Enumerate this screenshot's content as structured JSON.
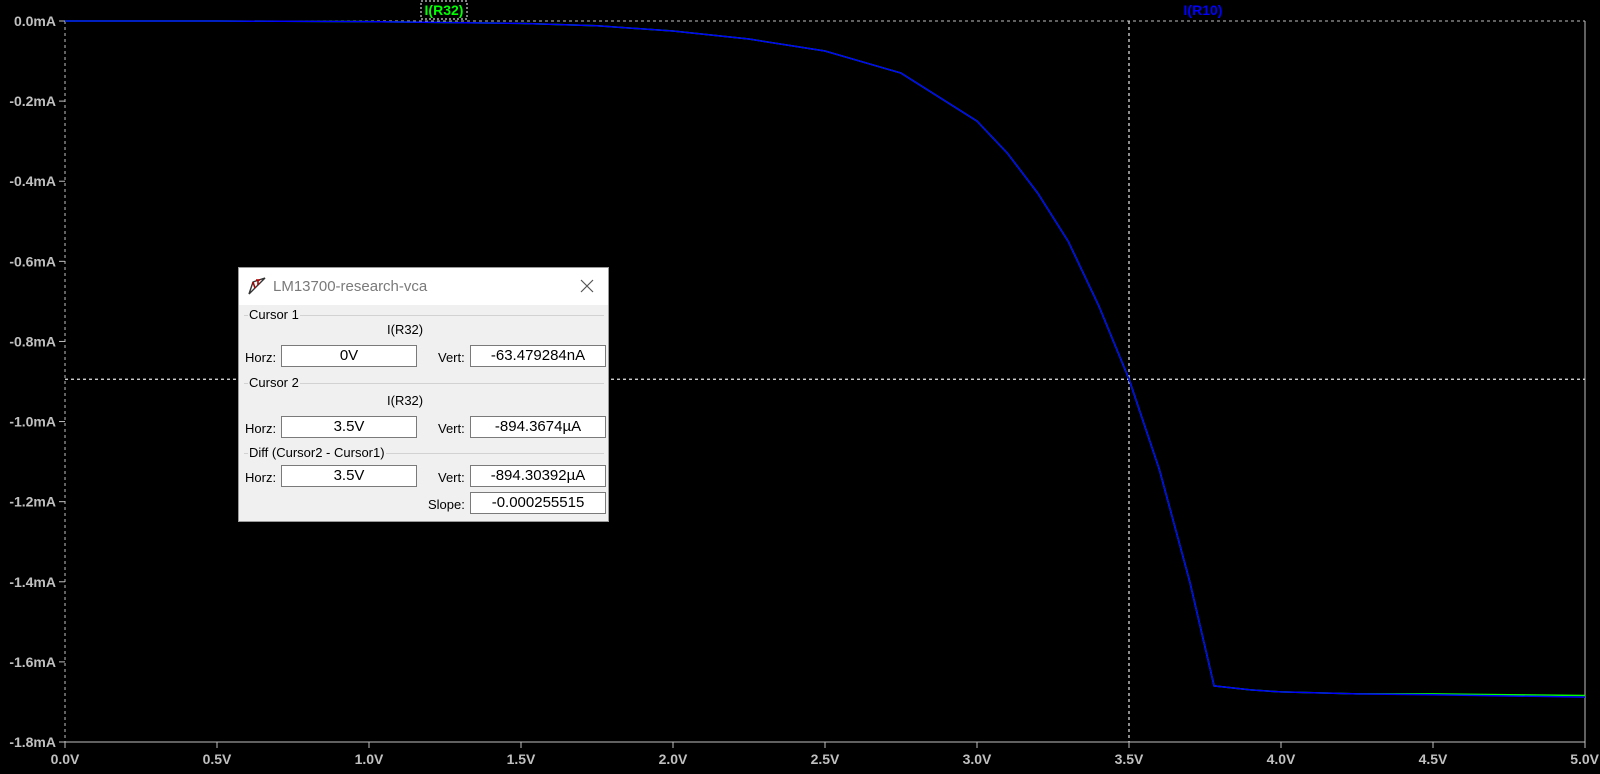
{
  "chart_data": {
    "type": "line",
    "x_ticks": [
      "0.0V",
      "0.5V",
      "1.0V",
      "1.5V",
      "2.0V",
      "2.5V",
      "3.0V",
      "3.5V",
      "4.0V",
      "4.5V",
      "5.0V"
    ],
    "y_ticks": [
      "0.0mA",
      "-0.2mA",
      "-0.4mA",
      "-0.6mA",
      "-0.8mA",
      "-1.0mA",
      "-1.2mA",
      "-1.4mA",
      "-1.6mA",
      "-1.8mA"
    ],
    "xlim": [
      0,
      5
    ],
    "ylim": [
      -1.8,
      0
    ],
    "x_unit": "V",
    "y_unit": "mA",
    "grid": false,
    "background": "#000000",
    "axis_color": "#c0c0c0",
    "series": [
      {
        "name": "I(R32)",
        "color": "#00ff00",
        "x": [
          0,
          0.5,
          1.0,
          1.5,
          1.75,
          2.0,
          2.25,
          2.5,
          2.75,
          3.0,
          3.1,
          3.2,
          3.3,
          3.4,
          3.5,
          3.6,
          3.7,
          3.78,
          3.9,
          4.0,
          4.25,
          4.5,
          4.75,
          5.0
        ],
        "y": [
          0,
          -0.0001,
          -0.0016,
          -0.006,
          -0.012,
          -0.025,
          -0.045,
          -0.075,
          -0.13,
          -0.25,
          -0.33,
          -0.43,
          -0.55,
          -0.71,
          -0.894,
          -1.12,
          -1.4,
          -1.66,
          -1.67,
          -1.675,
          -1.68,
          -1.68,
          -1.682,
          -1.684
        ]
      },
      {
        "name": "I(R10)",
        "color": "#0000ff",
        "x": [
          0,
          0.5,
          1.0,
          1.5,
          1.75,
          2.0,
          2.25,
          2.5,
          2.75,
          3.0,
          3.1,
          3.2,
          3.3,
          3.4,
          3.5,
          3.6,
          3.7,
          3.78,
          3.9,
          4.0,
          4.25,
          4.5,
          4.75,
          5.0
        ],
        "y": [
          0,
          -0.0001,
          -0.0016,
          -0.006,
          -0.012,
          -0.025,
          -0.045,
          -0.075,
          -0.13,
          -0.25,
          -0.33,
          -0.43,
          -0.55,
          -0.71,
          -0.894,
          -1.12,
          -1.4,
          -1.66,
          -1.67,
          -1.675,
          -1.68,
          -1.682,
          -1.685,
          -1.688
        ]
      }
    ],
    "cursors": [
      {
        "x": 0,
        "y": -6.3479e-05
      },
      {
        "x": 3.5,
        "y": -0.8943674
      }
    ]
  },
  "dialog": {
    "title": "LM13700-research-vca",
    "cursor1": {
      "label": "Cursor 1",
      "trace": "I(R32)",
      "horz_label": "Horz:",
      "horz_value": "0V",
      "vert_label": "Vert:",
      "vert_value": "-63.479284nA"
    },
    "cursor2": {
      "label": "Cursor 2",
      "trace": "I(R32)",
      "horz_label": "Horz:",
      "horz_value": "3.5V",
      "vert_label": "Vert:",
      "vert_value": "-894.3674µA"
    },
    "diff": {
      "label": "Diff (Cursor2 - Cursor1)",
      "horz_label": "Horz:",
      "horz_value": "3.5V",
      "vert_label": "Vert:",
      "vert_value": "-894.30392µA",
      "slope_label": "Slope:",
      "slope_value": "-0.000255515"
    },
    "icons": {
      "app": "ltspice-app-icon",
      "close": "close-icon"
    }
  }
}
